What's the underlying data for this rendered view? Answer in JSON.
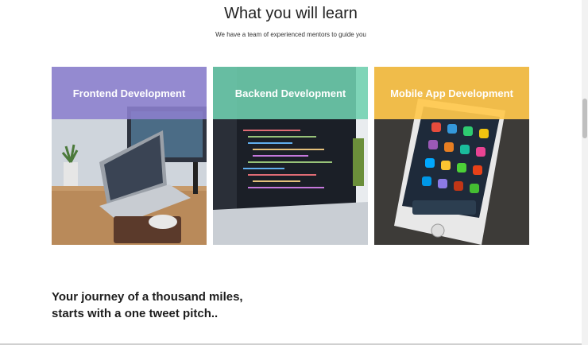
{
  "section": {
    "title": "What you will learn",
    "subtitle": "We have a team of experienced mentors to guide you"
  },
  "cards": [
    {
      "label": "Frontend Development",
      "band_color": "#8c7fce"
    },
    {
      "label": "Backend Development",
      "band_color": "#6fd1b1"
    },
    {
      "label": "Mobile App Development",
      "band_color": "#ffc84c"
    }
  ],
  "journey": {
    "line1": "Your journey of a thousand miles,",
    "line2": "starts with a one tweet pitch.."
  }
}
